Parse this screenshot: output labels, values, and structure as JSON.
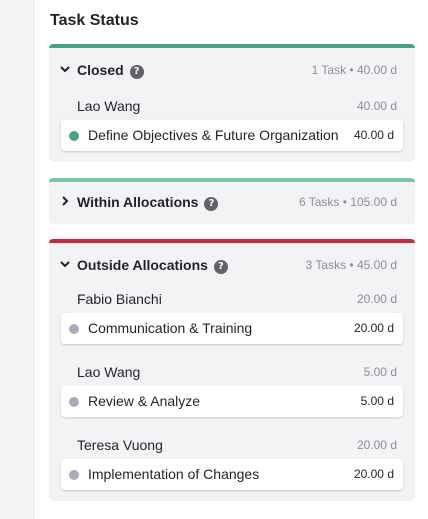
{
  "title": "Task Status",
  "colors": {
    "closed_accent": "#48a287",
    "within_accent": "#7ac7a6",
    "outside_accent": "#c9293a",
    "closed_dot": "#48a287",
    "open_dot": "#a9abbc"
  },
  "groups": [
    {
      "name": "Closed",
      "summary": "1 Task • 40.00 d",
      "expanded": true,
      "help_icon": "question-circle-icon",
      "people": [
        {
          "name": "Lao Wang",
          "value": "40.00 d",
          "tasks": [
            {
              "name": "Define Objectives & Future Organization",
              "value": "40.00 d",
              "status": "closed"
            }
          ]
        }
      ]
    },
    {
      "name": "Within Allocations",
      "summary": "6 Tasks • 105.00 d",
      "expanded": false,
      "help_icon": "question-circle-icon"
    },
    {
      "name": "Outside Allocations",
      "summary": "3 Tasks • 45.00 d",
      "expanded": true,
      "help_icon": "question-circle-icon",
      "people": [
        {
          "name": "Fabio Bianchi",
          "value": "20.00 d",
          "tasks": [
            {
              "name": "Communication & Training",
              "value": "20.00 d",
              "status": "open"
            }
          ]
        },
        {
          "name": "Lao Wang",
          "value": "5.00 d",
          "tasks": [
            {
              "name": "Review & Analyze",
              "value": "5.00 d",
              "status": "open"
            }
          ]
        },
        {
          "name": "Teresa Vuong",
          "value": "20.00 d",
          "tasks": [
            {
              "name": "Implementation of Changes",
              "value": "20.00 d",
              "status": "open"
            }
          ]
        }
      ]
    }
  ]
}
